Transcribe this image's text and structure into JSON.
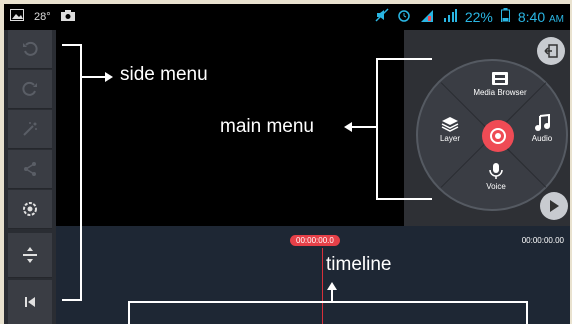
{
  "status_bar": {
    "temperature": "28°",
    "battery_percent": "22%",
    "time": "8:40",
    "ampm": "AM"
  },
  "side_menu": {
    "items": [
      "undo-icon",
      "redo-icon",
      "effects-icon",
      "share-icon",
      "settings-icon",
      "adjust-icon",
      "skip-start-icon"
    ]
  },
  "main_menu": {
    "media_browser_label": "Media Browser",
    "layer_label": "Layer",
    "audio_label": "Audio",
    "voice_label": "Voice"
  },
  "timeline": {
    "current_time": "00:00:00.0",
    "end_time": "00:00:00.00"
  },
  "annotations": {
    "side_menu": "side menu",
    "main_menu": "main menu",
    "timeline": "timeline"
  },
  "colors": {
    "accent_red": "#ef4b55",
    "status_blue": "#2ab6e3",
    "timeline_bg": "#1e2734"
  }
}
